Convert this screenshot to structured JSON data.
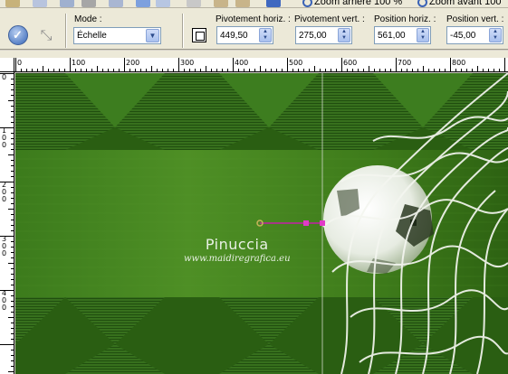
{
  "toolbar": {
    "zoom_out_label": "Zoom arrière 100 %",
    "zoom_in_label": "Zoom avant 100"
  },
  "options": {
    "mode_label": "Mode :",
    "mode_value": "Échelle",
    "pivot_h_label": "Pivotement horiz. :",
    "pivot_h_value": "449,50",
    "pivot_v_label": "Pivotement vert. :",
    "pivot_v_value": "275,00",
    "pos_h_label": "Position horiz. :",
    "pos_h_value": "561,00",
    "pos_v_label": "Position vert. :",
    "pos_v_value": "-45,00"
  },
  "ruler_top": {
    "labels": [
      "0",
      "100",
      "200",
      "300",
      "400",
      "500",
      "600",
      "700",
      "800"
    ]
  },
  "ruler_left": {
    "labels": [
      "0",
      "100",
      "200",
      "300",
      "400"
    ]
  },
  "canvas": {
    "watermark_title": "Pinuccia",
    "watermark_url": "www.maidiregrafica.eu"
  },
  "icons": {
    "apply": "apply-icon",
    "pick_tool": "pick-tool-icon",
    "transform": "transform-icon"
  }
}
